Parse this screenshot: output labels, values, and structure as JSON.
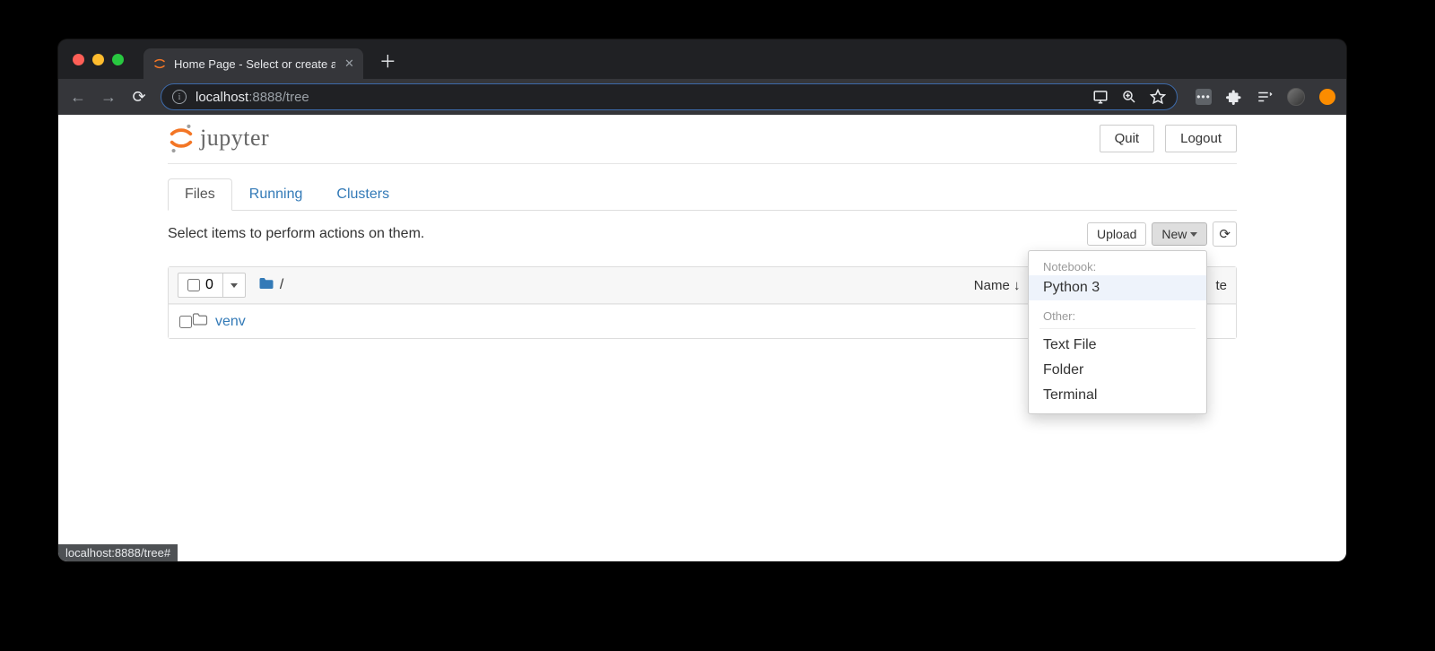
{
  "browser": {
    "tab_title": "Home Page - Select or create a",
    "url_host": "localhost",
    "url_port_path": ":8888/tree",
    "status_tooltip": "localhost:8888/tree#"
  },
  "header": {
    "logo_text": "jupyter",
    "quit_label": "Quit",
    "logout_label": "Logout"
  },
  "tabs": {
    "files": "Files",
    "running": "Running",
    "clusters": "Clusters"
  },
  "actions": {
    "hint": "Select items to perform actions on them.",
    "upload_label": "Upload",
    "new_label": "New"
  },
  "list": {
    "selected_count": "0",
    "breadcrumb_sep": "/",
    "col_name": "Name",
    "col_file_size_trail": "te",
    "rows": [
      {
        "name": "venv"
      }
    ]
  },
  "new_menu": {
    "section_notebook": "Notebook:",
    "item_python3": "Python 3",
    "section_other": "Other:",
    "item_textfile": "Text File",
    "item_folder": "Folder",
    "item_terminal": "Terminal"
  }
}
